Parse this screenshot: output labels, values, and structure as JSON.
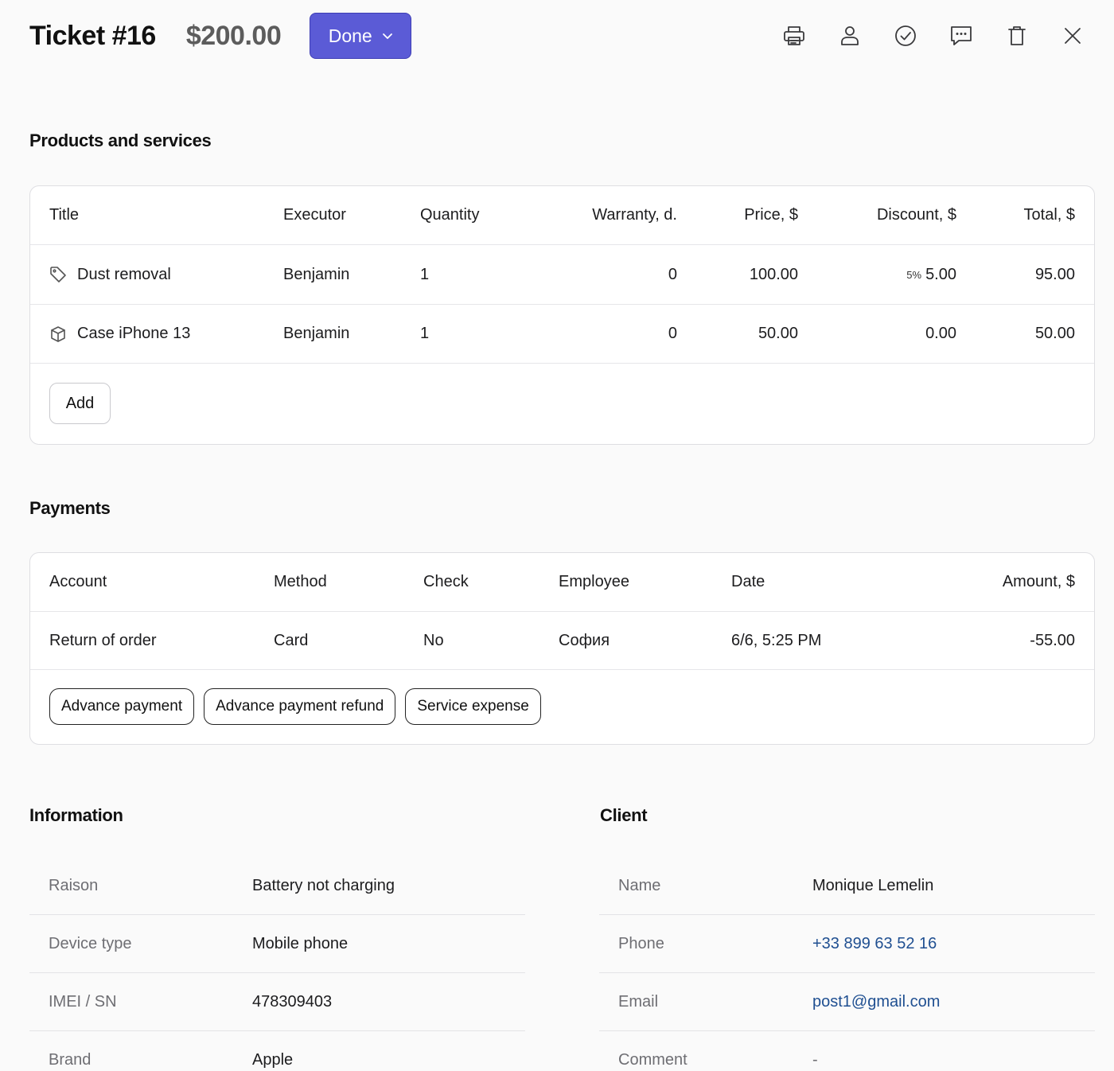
{
  "header": {
    "title": "Ticket #16",
    "amount": "$200.00",
    "status": "Done",
    "accent_color": "#5b5bd6",
    "actions": [
      "print-icon",
      "user-icon",
      "check-circle-icon",
      "comment-icon",
      "trash-icon",
      "close-icon"
    ]
  },
  "products": {
    "section_title": "Products and services",
    "columns": [
      "Title",
      "Executor",
      "Quantity",
      "Warranty, d.",
      "Price, $",
      "Discount, $",
      "Total, $"
    ],
    "rows": [
      {
        "icon": "tag-icon",
        "title": "Dust removal",
        "executor": "Benjamin",
        "quantity": "1",
        "warranty": "0",
        "price": "100.00",
        "discount_pct": "5%",
        "discount": "5.00",
        "total": "95.00"
      },
      {
        "icon": "box-icon",
        "title": "Case iPhone 13",
        "executor": "Benjamin",
        "quantity": "1",
        "warranty": "0",
        "price": "50.00",
        "discount_pct": "",
        "discount": "0.00",
        "total": "50.00"
      }
    ],
    "add_label": "Add"
  },
  "payments": {
    "section_title": "Payments",
    "columns": [
      "Account",
      "Method",
      "Check",
      "Employee",
      "Date",
      "Amount, $"
    ],
    "rows": [
      {
        "account": "Return of order",
        "method": "Card",
        "check": "No",
        "employee": "София",
        "date": "6/6, 5:25 PM",
        "amount": "-55.00"
      }
    ],
    "buttons": [
      "Advance payment",
      "Advance payment refund",
      "Service expense"
    ]
  },
  "information": {
    "section_title": "Information",
    "items": [
      {
        "label": "Raison",
        "value": "Battery not charging"
      },
      {
        "label": "Device type",
        "value": "Mobile phone"
      },
      {
        "label": "IMEI / SN",
        "value": "478309403"
      },
      {
        "label": "Brand",
        "value": "Apple"
      }
    ]
  },
  "client": {
    "section_title": "Client",
    "items": [
      {
        "label": "Name",
        "value": "Monique Lemelin"
      },
      {
        "label": "Phone",
        "value": "+33 899 63 52 16"
      },
      {
        "label": "Email",
        "value": "post1@gmail.com"
      },
      {
        "label": "Comment",
        "value": "-"
      }
    ],
    "link_color": "#1f4f91"
  }
}
